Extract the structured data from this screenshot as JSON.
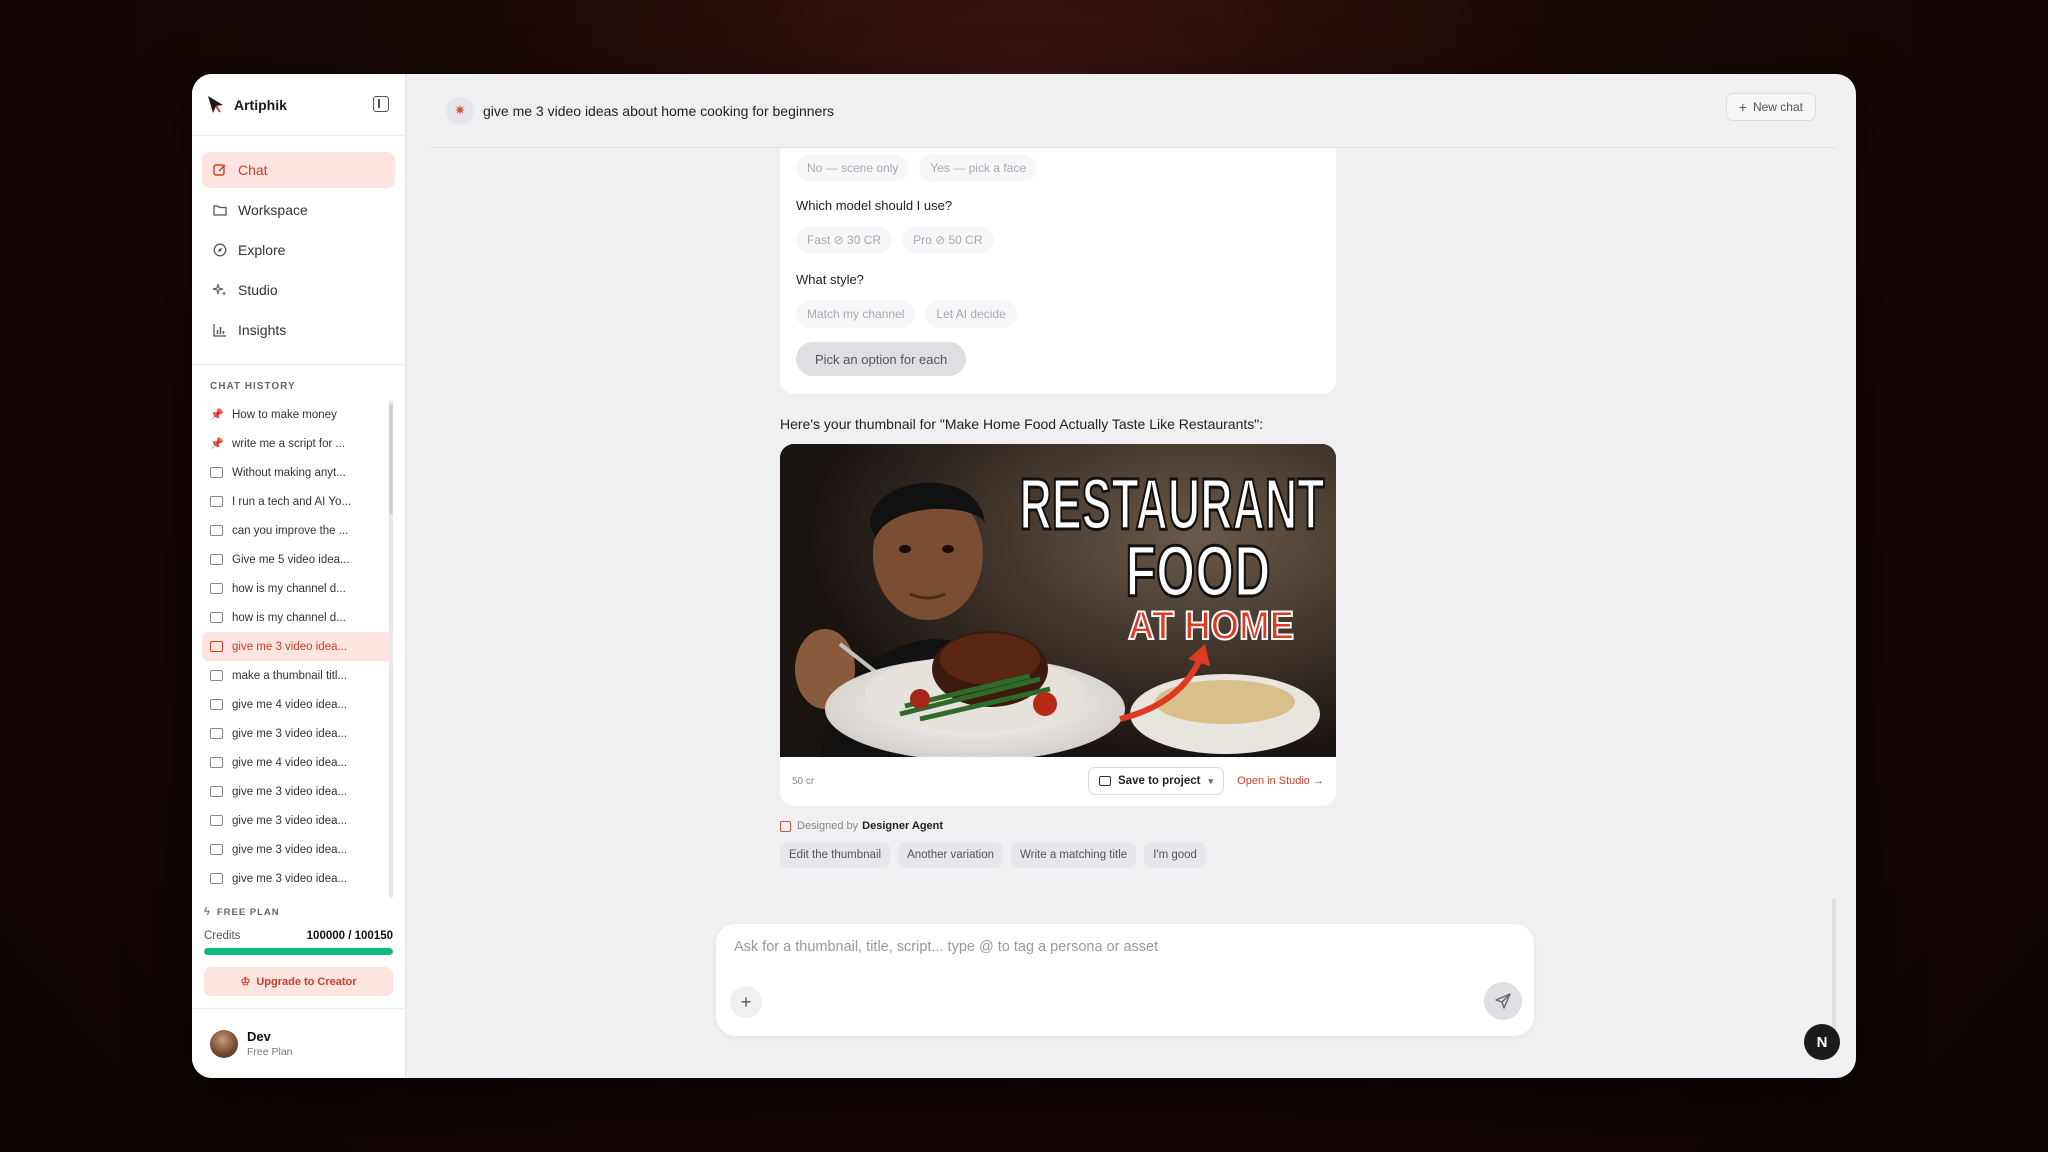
{
  "app": {
    "name": "Artiphik"
  },
  "nav": [
    {
      "label": "Chat",
      "icon": "edit-icon",
      "active": true
    },
    {
      "label": "Workspace",
      "icon": "folder-icon"
    },
    {
      "label": "Explore",
      "icon": "compass-icon"
    },
    {
      "label": "Studio",
      "icon": "sparkles-icon"
    },
    {
      "label": "Insights",
      "icon": "bar-chart-icon"
    }
  ],
  "history": {
    "title": "CHAT HISTORY",
    "items": [
      {
        "label": "How to make money",
        "pinned": true
      },
      {
        "label": "write me a script for ...",
        "pinned": true
      },
      {
        "label": "Without making anyt..."
      },
      {
        "label": "I run a tech and AI Yo..."
      },
      {
        "label": "can you improve the ..."
      },
      {
        "label": "Give me 5 video idea..."
      },
      {
        "label": "how is my channel d..."
      },
      {
        "label": "how is my channel d..."
      },
      {
        "label": "give me 3 video idea...",
        "active": true
      },
      {
        "label": "make a thumbnail titl..."
      },
      {
        "label": "give me 4 video idea..."
      },
      {
        "label": "give me 3 video idea..."
      },
      {
        "label": "give me 4 video idea..."
      },
      {
        "label": "give me 3 video idea..."
      },
      {
        "label": "give me 3 video idea..."
      },
      {
        "label": "give me 3 video idea..."
      },
      {
        "label": "give me 3 video idea..."
      }
    ]
  },
  "plan": {
    "label": "FREE PLAN",
    "credits_label": "Credits",
    "credits_value": "100000 / 100150",
    "credits_fraction": 0.9985,
    "upgrade_label": "Upgrade to Creator"
  },
  "user": {
    "name": "Dev",
    "plan": "Free Plan"
  },
  "header": {
    "title": "give me 3 video ideas about home cooking for beginners",
    "new_chat_label": "New chat"
  },
  "form": {
    "row1": [
      "No — scene only",
      "Yes — pick a face"
    ],
    "q2": "Which model should I use?",
    "row2": [
      "Fast ⊘ 30 CR",
      "Pro ⊘ 50 CR"
    ],
    "q3": "What style?",
    "row3": [
      "Match my channel",
      "Let AI decide"
    ],
    "submit_label": "Pick an option for each"
  },
  "thumbnail": {
    "caption": "Here's your thumbnail for \"Make Home Food Actually Taste Like Restaurants\":",
    "headline_1": "RESTAURANT",
    "headline_2": "FOOD",
    "headline_3": "AT HOME",
    "cost": "50 cr",
    "save_label": "Save to project",
    "open_label": "Open in Studio →"
  },
  "designed_by": {
    "prefix": "Designed by",
    "agent": "Designer Agent"
  },
  "chips": [
    "Edit the thumbnail",
    "Another variation",
    "Write a matching title",
    "I'm good"
  ],
  "composer": {
    "placeholder": "Ask for a thumbnail, title, script... type @ to tag a persona or asset",
    "value": ""
  },
  "badge": "N",
  "colors": {
    "accent": "#c8402a",
    "accent_bg": "#fde4e1",
    "progress": "#10b981"
  }
}
